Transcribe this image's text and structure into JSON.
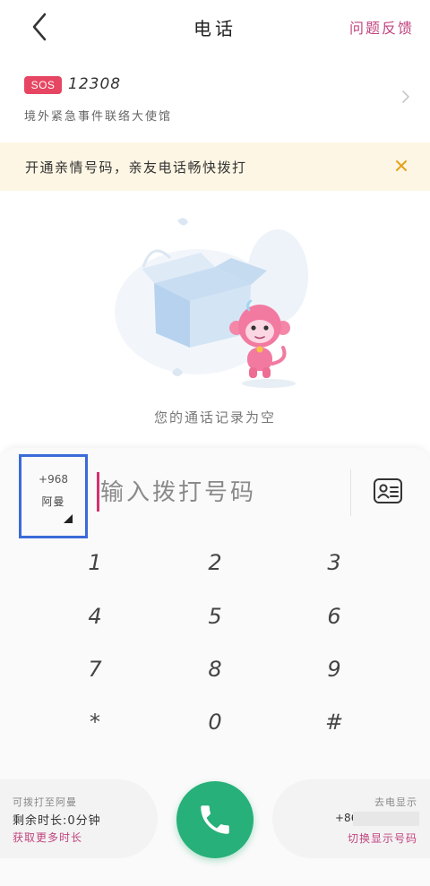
{
  "nav": {
    "title": "电话",
    "feedback_label": "问题反馈"
  },
  "sos": {
    "badge": "SOS",
    "number": "12308",
    "description": "境外紧急事件联络大使馆"
  },
  "banner": {
    "text": "开通亲情号码，亲友电话畅快拨打"
  },
  "empty_state": {
    "message": "您的通话记录为空"
  },
  "dialer": {
    "country_code": "+968",
    "country_name": "阿曼",
    "input_placeholder": "输入拨打号码",
    "keys": [
      "1",
      "2",
      "3",
      "4",
      "5",
      "6",
      "7",
      "8",
      "9",
      "*",
      "0",
      "#"
    ]
  },
  "bottom": {
    "left_line1": "可拨打至阿曼",
    "left_line2": "剩余时长:0分钟",
    "left_link": "获取更多时长",
    "right_line1": "去电显示",
    "right_prefix": "+86",
    "right_link": "切换显示号码"
  },
  "colors": {
    "accent_pink": "#c2447f",
    "sos_red": "#e64662",
    "call_green": "#27b079",
    "banner_bg": "#fdf6e4",
    "banner_close": "#e5a21c",
    "selection_blue": "#3b6ad9"
  }
}
